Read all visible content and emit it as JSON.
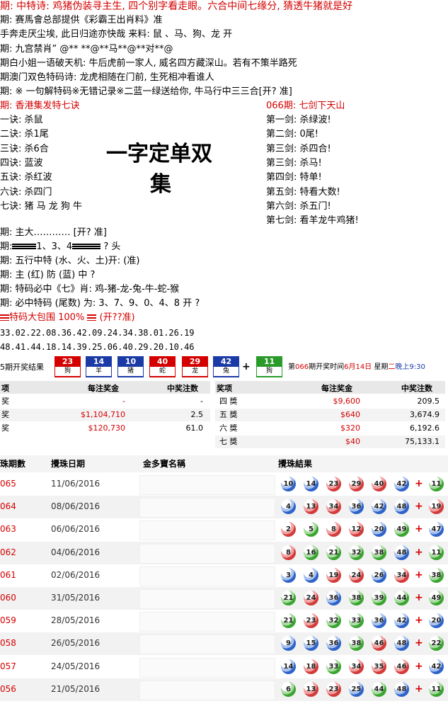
{
  "header": {
    "line1": "期: 中特诗: 鸡猪伪装寻主生, 四个别字看走眼。六合中间七缘分, 猜透牛猪就是好",
    "line2": "期: 赛馬會总部提供《彩霸王出肖料》准",
    "line3": "手奔走厌尘埃, 此日归途亦快哉 来料: 鼠 、马、狗、龙 开",
    "line4": "期: 九宫禁肖” @** **@**马**@**对**@",
    "line5": "期白小姐一语破天机: 牛后虎前一家人, 威名四方藏深山。若有不策半路死",
    "line6": "期澳门双色特码诗: 龙虎相随在门前, 生死相冲看谁人",
    "line7": "期: ※ 一句解特码※无错记录※二蓝一绿送给你, 牛马行中三三合[开? 准]"
  },
  "left": {
    "title": "期: 香港集发特七诀",
    "items": [
      "一诀: 杀鼠",
      "二诀: 杀1尾",
      "三诀: 杀6合",
      "四诀: 蓝波",
      "五诀: 杀红波",
      "六诀: 杀四门",
      "七诀: 猪 马 龙 狗 牛"
    ]
  },
  "right": {
    "title": "066期: 七剑下天山",
    "items": [
      "第一剑: 杀绿波!",
      "第二剑: 0尾!",
      "第三剑: 杀四合!",
      "第三剑: 杀马!",
      "第四剑: 特单!",
      "第五剑: 特看大数!",
      "第六剑: 杀五门!",
      "第七剑: 看羊龙牛鸡猪!"
    ]
  },
  "center": {
    "big1": "一字定单双",
    "big2": "集"
  },
  "mid": {
    "a": "期: 主大………… [开? 准]",
    "b_pre": "期:",
    "b_mid": "1、3、4",
    "b_post": "? 头",
    "c": "期: 五行中特 (水、火、土)开: (准)",
    "d": "期: 主 (红) 防 (蓝) 中 ?",
    "e": "期: 特码必中《七》肖: 鸡-猪-龙-兔-牛-蛇-猴",
    "f": "期: 必中特码 (尾数) 为: 3、7、9、0、4、8 开 ?",
    "g_text": "特码大包围 100%",
    "g_tail": "(开??准)",
    "h": "33.02.22.08.36.42.09.24.34.38.01.26.19",
    "i": "48.41.44.18.14.39.25.06.40.29.20.10.46"
  },
  "draw": {
    "label": "5期开奖结果",
    "balls": [
      {
        "n": "23",
        "z": "狗",
        "color": "#d40000"
      },
      {
        "n": "14",
        "z": "羊",
        "color": "#1a3aa6"
      },
      {
        "n": "10",
        "z": "猪",
        "color": "#1a3aa6"
      },
      {
        "n": "40",
        "z": "蛇",
        "color": "#d40000"
      },
      {
        "n": "29",
        "z": "龙",
        "color": "#d40000"
      },
      {
        "n": "42",
        "z": "兔",
        "color": "#1a3aa6"
      }
    ],
    "plus": "+",
    "special": {
      "n": "11",
      "z": "狗",
      "color": "#2a9a2a"
    },
    "next_pre": "第",
    "next_no": "066",
    "next_mid": "期开奖时间",
    "next_date": "6月14日",
    "next_week": " 星期",
    "next_day": "二",
    "next_time": "晚上9:30"
  },
  "prize_left": {
    "headers": [
      "项",
      "每注奖金",
      "中奖注数"
    ],
    "rows": [
      [
        "奖",
        "-",
        "-"
      ],
      [
        "奖",
        "$1,104,710",
        "2.5"
      ],
      [
        "奖",
        "$120,730",
        "61.0"
      ]
    ]
  },
  "prize_right": {
    "headers": [
      "奖项",
      "每注奖金",
      "中奖注数"
    ],
    "rows": [
      [
        "四 獎",
        "$9,600",
        "209.5"
      ],
      [
        "五 獎",
        "$640",
        "3,674.9"
      ],
      [
        "六 獎",
        "$320",
        "6,192.6"
      ],
      [
        "七 獎",
        "$40",
        "75,133.1"
      ]
    ]
  },
  "history": {
    "headers": [
      "珠期數",
      "攪珠日期",
      "金多寶名稱",
      "攪珠結果"
    ],
    "rows": [
      {
        "id": "065",
        "date": "11/06/2016",
        "balls": [
          [
            "10",
            "b"
          ],
          [
            "14",
            "b"
          ],
          [
            "23",
            "r"
          ],
          [
            "29",
            "r"
          ],
          [
            "40",
            "r"
          ],
          [
            "42",
            "b"
          ]
        ],
        "sp": [
          "11",
          "g"
        ]
      },
      {
        "id": "064",
        "date": "08/06/2016",
        "balls": [
          [
            "4",
            "b"
          ],
          [
            "13",
            "r"
          ],
          [
            "34",
            "r"
          ],
          [
            "36",
            "b"
          ],
          [
            "42",
            "b"
          ],
          [
            "48",
            "b"
          ]
        ],
        "sp": [
          "19",
          "r"
        ]
      },
      {
        "id": "063",
        "date": "06/06/2016",
        "balls": [
          [
            "2",
            "r"
          ],
          [
            "5",
            "g"
          ],
          [
            "8",
            "r"
          ],
          [
            "12",
            "r"
          ],
          [
            "20",
            "b"
          ],
          [
            "49",
            "g"
          ]
        ],
        "sp": [
          "47",
          "b"
        ]
      },
      {
        "id": "062",
        "date": "04/06/2016",
        "balls": [
          [
            "8",
            "r"
          ],
          [
            "16",
            "g"
          ],
          [
            "21",
            "g"
          ],
          [
            "32",
            "g"
          ],
          [
            "38",
            "g"
          ],
          [
            "48",
            "b"
          ]
        ],
        "sp": [
          "11",
          "g"
        ]
      },
      {
        "id": "061",
        "date": "02/06/2016",
        "balls": [
          [
            "3",
            "b"
          ],
          [
            "4",
            "b"
          ],
          [
            "19",
            "r"
          ],
          [
            "24",
            "r"
          ],
          [
            "26",
            "b"
          ],
          [
            "34",
            "r"
          ]
        ],
        "sp": [
          "38",
          "g"
        ]
      },
      {
        "id": "060",
        "date": "31/05/2016",
        "balls": [
          [
            "21",
            "g"
          ],
          [
            "24",
            "r"
          ],
          [
            "36",
            "b"
          ],
          [
            "38",
            "g"
          ],
          [
            "39",
            "g"
          ],
          [
            "44",
            "g"
          ]
        ],
        "sp": [
          "49",
          "g"
        ]
      },
      {
        "id": "059",
        "date": "28/05/2016",
        "balls": [
          [
            "21",
            "g"
          ],
          [
            "23",
            "r"
          ],
          [
            "32",
            "g"
          ],
          [
            "33",
            "g"
          ],
          [
            "36",
            "b"
          ],
          [
            "42",
            "b"
          ]
        ],
        "sp": [
          "20",
          "b"
        ]
      },
      {
        "id": "058",
        "date": "26/05/2016",
        "balls": [
          [
            "9",
            "b"
          ],
          [
            "15",
            "b"
          ],
          [
            "36",
            "b"
          ],
          [
            "38",
            "g"
          ],
          [
            "46",
            "r"
          ],
          [
            "48",
            "b"
          ]
        ],
        "sp": [
          "22",
          "g"
        ]
      },
      {
        "id": "057",
        "date": "24/05/2016",
        "balls": [
          [
            "14",
            "b"
          ],
          [
            "18",
            "r"
          ],
          [
            "33",
            "g"
          ],
          [
            "34",
            "r"
          ],
          [
            "35",
            "r"
          ],
          [
            "46",
            "r"
          ]
        ],
        "sp": [
          "42",
          "b"
        ]
      },
      {
        "id": "056",
        "date": "21/05/2016",
        "balls": [
          [
            "6",
            "g"
          ],
          [
            "13",
            "r"
          ],
          [
            "23",
            "r"
          ],
          [
            "25",
            "b"
          ],
          [
            "44",
            "g"
          ],
          [
            "48",
            "b"
          ]
        ],
        "sp": [
          "11",
          "g"
        ]
      }
    ]
  }
}
